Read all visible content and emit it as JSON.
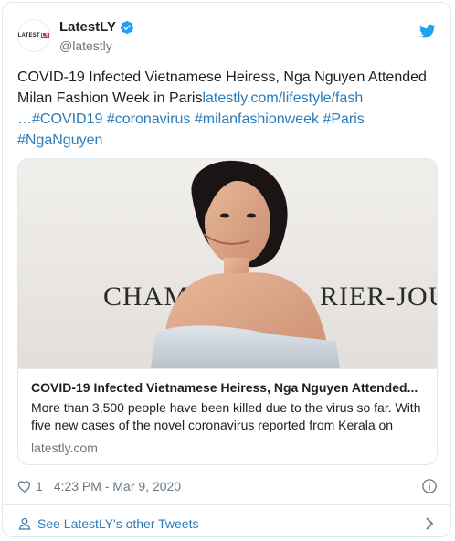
{
  "account": {
    "display_name": "LatestLY",
    "handle": "@latestly",
    "avatar_text": "LATEST",
    "avatar_badge": "LY"
  },
  "tweet": {
    "text_line1": "COVID-19 Infected Vietnamese Heiress, Nga Nguyen Attended",
    "text_line2_plain": "Milan Fashion Week in Paris",
    "text_link": "latestly.com/lifestyle/fash",
    "text_link_cont": "…",
    "hashtags": [
      "#COVID19",
      "#coronavirus",
      "#milanfashionweek",
      "#Paris",
      "#NgaNguyen"
    ]
  },
  "card": {
    "image_sign_left": "CHAMPA",
    "image_sign_right": "RIER-JOUË",
    "title": "COVID-19 Infected Vietnamese Heiress, Nga Nguyen Attended...",
    "description": "More than 3,500 people have been killed due to the virus so far. With five new cases of the novel coronavirus reported from Kerala on",
    "domain": "latestly.com"
  },
  "meta": {
    "like_count": "1",
    "timestamp": "4:23 PM - Mar 9, 2020"
  },
  "footer": {
    "see_more": "See LatestLY's other Tweets"
  },
  "colors": {
    "link": "#2b7bb9",
    "muted": "#697882",
    "verified": "#1da1f2",
    "twitter_bird": "#1da1f2"
  },
  "icons": [
    "verified-badge-icon",
    "twitter-bird-icon",
    "heart-icon",
    "info-icon",
    "person-icon",
    "chevron-right-icon"
  ]
}
